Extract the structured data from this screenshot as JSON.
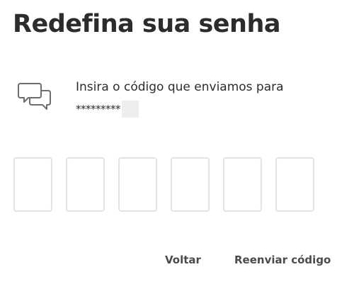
{
  "header": {
    "title": "Redefina sua senha"
  },
  "verification": {
    "icon": "chat-bubbles-icon",
    "instruction": "Insira o código que enviamos para",
    "masked_destination": "*********"
  },
  "code_inputs": {
    "count": 6,
    "values": [
      "",
      "",
      "",
      "",
      "",
      ""
    ]
  },
  "actions": {
    "back_label": "Voltar",
    "resend_label": "Reenviar código"
  },
  "colors": {
    "text": "#2c2c2c",
    "box_border": "#e3e3e3",
    "link": "#4b4b4b"
  }
}
